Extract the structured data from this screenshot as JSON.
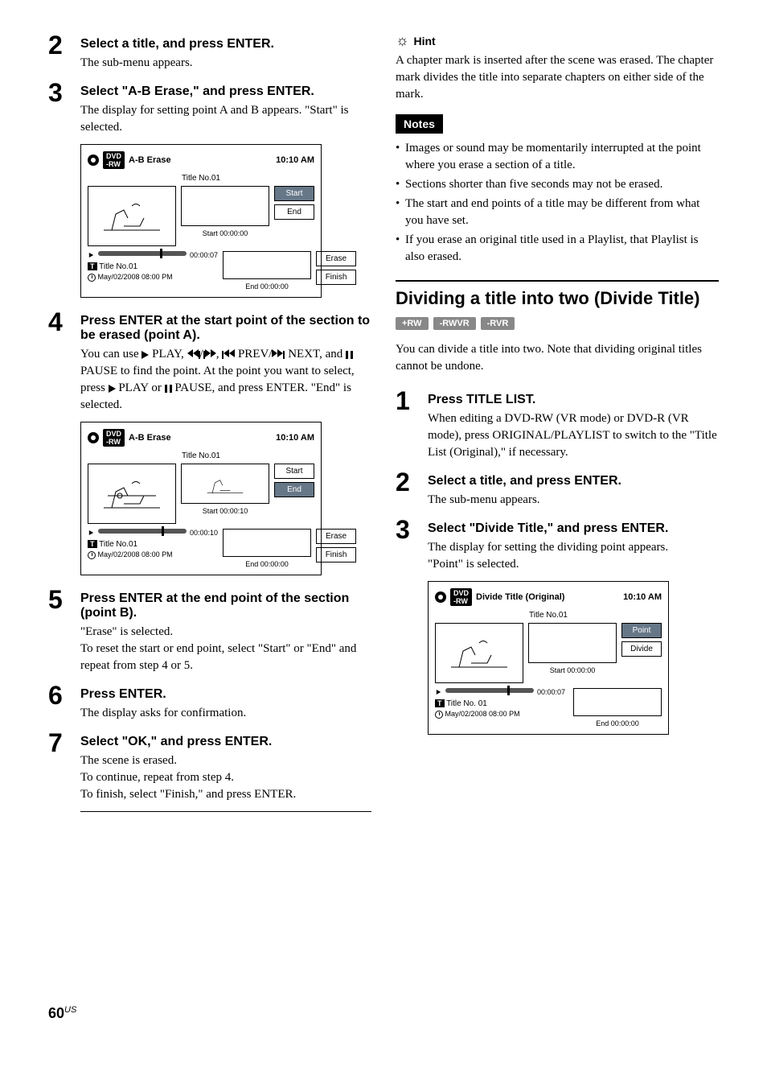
{
  "left": {
    "steps": [
      {
        "num": "2",
        "title": "Select a title, and press ENTER.",
        "text": "The sub-menu appears."
      },
      {
        "num": "3",
        "title": "Select \"A-B Erase,\" and press ENTER.",
        "text": "The display for setting point A and B appears. \"Start\" is selected."
      },
      {
        "num": "4",
        "title": "Press ENTER at the start point of the section to be erased (point A).",
        "text_parts": {
          "p1": "You can use ",
          "play": " PLAY, ",
          "prev": " PREV/",
          "next": " NEXT, and ",
          "pause": " PAUSE to find the point. At the point you want to select, press ",
          "play2": " PLAY or ",
          "pause2": " PAUSE, and press ENTER. \"End\" is selected."
        }
      },
      {
        "num": "5",
        "title": "Press ENTER at the end point of the section (point B).",
        "text": "\"Erase\" is selected.\nTo reset the start or end point, select \"Start\" or \"End\" and repeat from step 4 or 5."
      },
      {
        "num": "6",
        "title": "Press ENTER.",
        "text": "The display asks for confirmation."
      },
      {
        "num": "7",
        "title": "Select \"OK,\" and press ENTER.",
        "text": "The scene is erased.\nTo continue, repeat from step 4.\nTo finish, select \"Finish,\" and press ENTER."
      }
    ],
    "screen1": {
      "title_bar": "A-B Erase",
      "time": "10:10 AM",
      "title_no": "Title No.01",
      "start_time": "Start  00:00:00",
      "end_time": "End   00:00:00",
      "pos": "00:00:07",
      "title_line": "Title No.01",
      "date": "May/02/2008   08:00   PM",
      "buttons": [
        "Start",
        "End",
        "Erase",
        "Finish"
      ],
      "active_idx": 0
    },
    "screen2": {
      "title_bar": "A-B Erase",
      "time": "10:10 AM",
      "title_no": "Title No.01",
      "start_time": "Start  00:00:10",
      "end_time": "End   00:00:00",
      "pos": "00:00:10",
      "title_line": "Title No.01",
      "date": "May/02/2008   08:00   PM",
      "buttons": [
        "Start",
        "End",
        "Erase",
        "Finish"
      ],
      "active_idx": 1
    }
  },
  "right": {
    "hint_label": "Hint",
    "hint_text": "A chapter mark is inserted after the scene was erased. The chapter mark divides the title into separate chapters on either side of the mark.",
    "notes_label": "Notes",
    "notes": [
      "Images or sound may be momentarily interrupted at the point where you erase a section of a title.",
      "Sections shorter than five seconds may not be erased.",
      "The start and end points of a title may be different from what you have set.",
      "If you erase an original title used in a Playlist, that Playlist is also erased."
    ],
    "section_heading": "Dividing a title into two (Divide Title)",
    "formats": [
      "+RW",
      "-RWVR",
      "-RVR"
    ],
    "intro": "You can divide a title into two. Note that dividing original titles cannot be undone.",
    "steps": [
      {
        "num": "1",
        "title": "Press TITLE LIST.",
        "text": "When editing a DVD-RW (VR mode) or DVD-R (VR mode), press ORIGINAL/PLAYLIST to switch to the \"Title List (Original),\" if necessary."
      },
      {
        "num": "2",
        "title": "Select a title, and press ENTER.",
        "text": "The sub-menu appears."
      },
      {
        "num": "3",
        "title": "Select \"Divide Title,\" and press ENTER.",
        "text": "The display for setting the dividing point appears.\n\"Point\" is selected."
      }
    ],
    "screen3": {
      "title_bar": "Divide Title (Original)",
      "time": "10:10 AM",
      "title_no": "Title No.01",
      "start_time": "Start  00:00:00",
      "end_time": "End   00:00:00",
      "pos": "00:00:07",
      "title_line": "Title No. 01",
      "date": "May/02/2008   08:00   PM",
      "buttons": [
        "Point",
        "Divide"
      ],
      "active_idx": 0
    }
  },
  "page_num": "60",
  "page_suffix": "US"
}
